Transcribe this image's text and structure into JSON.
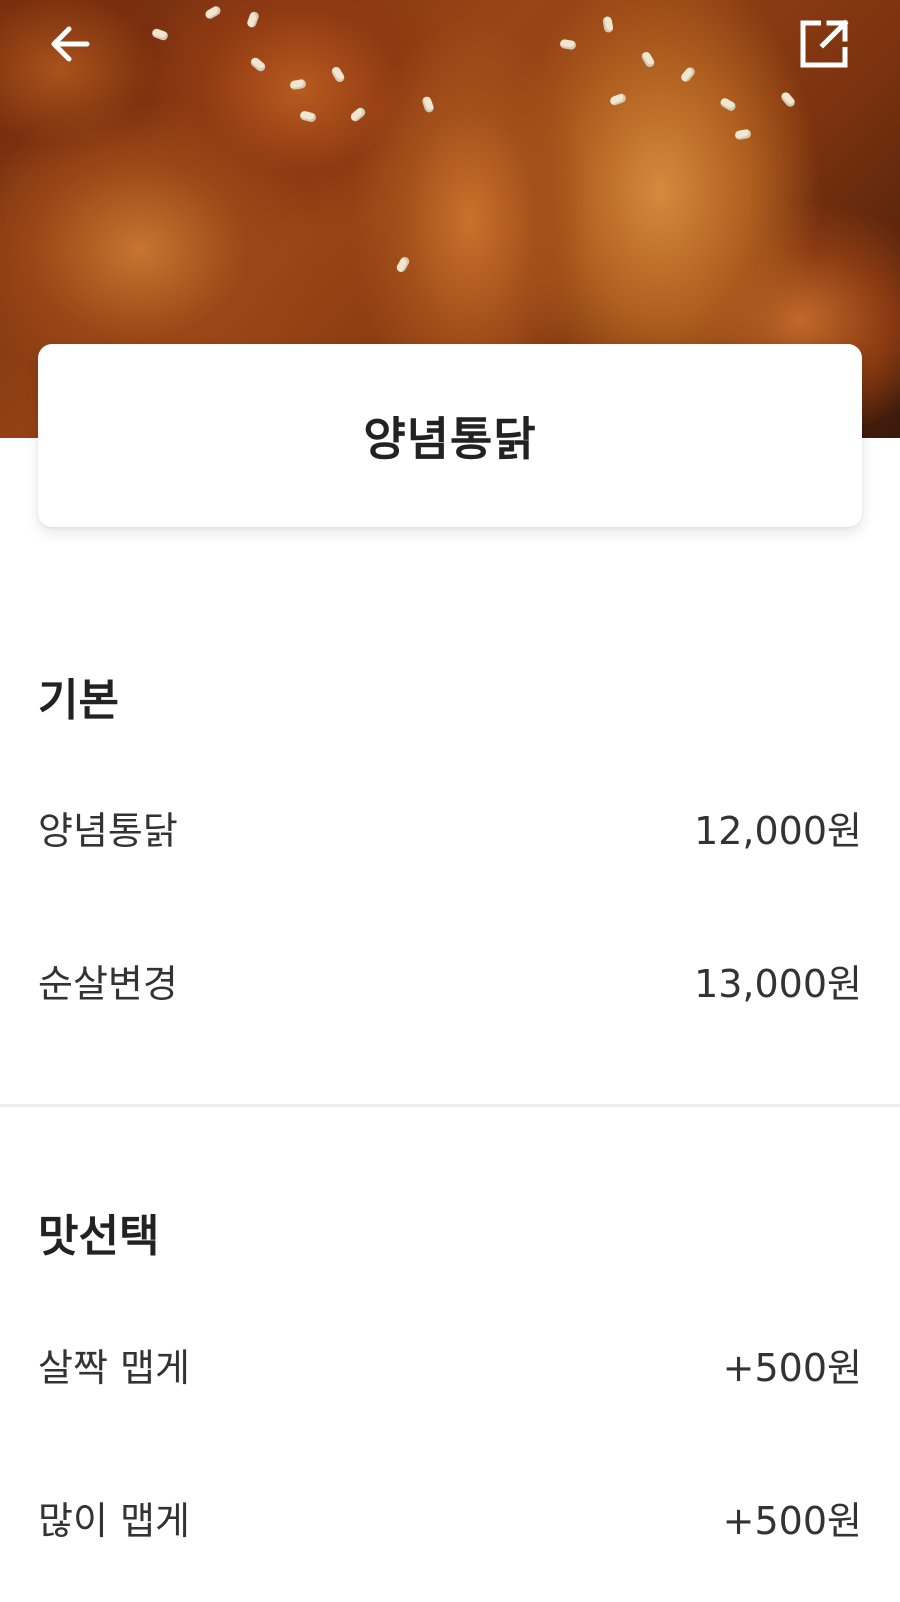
{
  "header": {
    "back_icon": "arrow-left-icon",
    "share_icon": "external-share-icon",
    "icon_color": "#ffffff"
  },
  "product": {
    "title": "양념통닭"
  },
  "sections": {
    "basic": {
      "title": "기본",
      "options": [
        {
          "label": "양념통닭",
          "price": "12,000원"
        },
        {
          "label": "순살변경",
          "price": "13,000원"
        }
      ]
    },
    "taste": {
      "title": "맛선택",
      "options": [
        {
          "label": "살짝 맵게",
          "price": "+500원"
        },
        {
          "label": "많이 맵게",
          "price": "+500원"
        }
      ]
    }
  }
}
